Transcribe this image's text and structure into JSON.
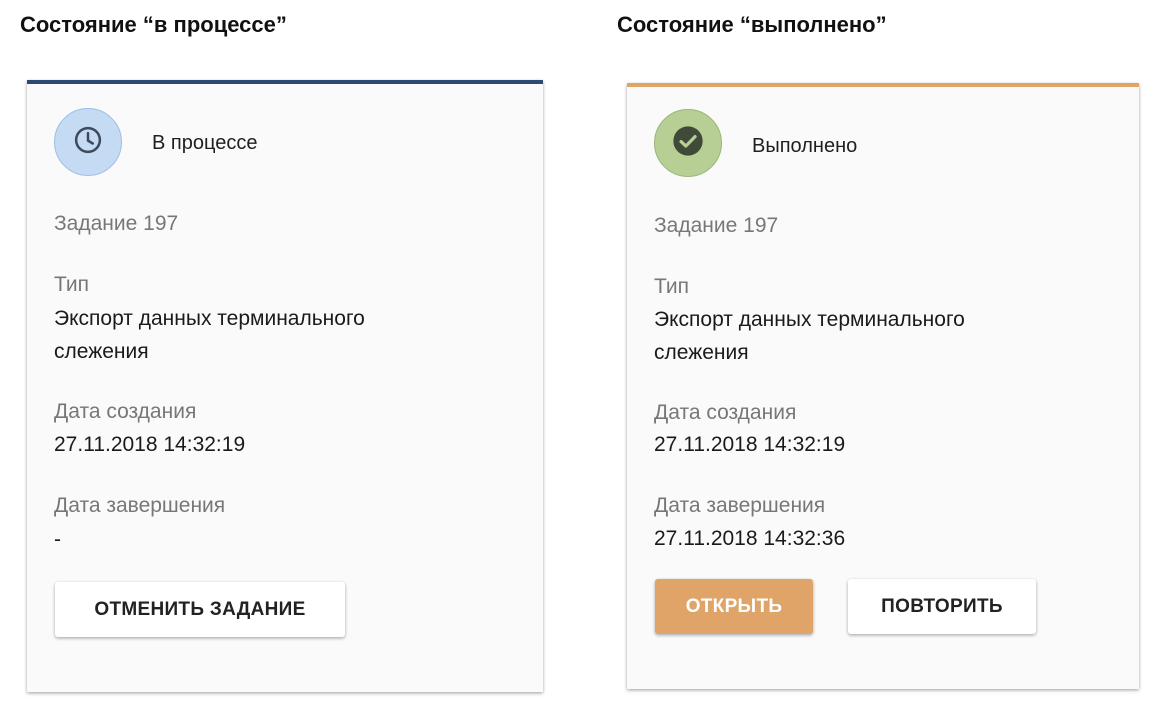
{
  "headings": {
    "in_progress": "Состояние “в процессе”",
    "done": "Состояние “выполнено”"
  },
  "colors": {
    "in_progress_accent": "#2b4a72",
    "done_accent": "#e0a468",
    "in_progress_icon_bg": "#c5daf3",
    "done_icon_bg": "#b7cf94"
  },
  "card_in_progress": {
    "status_icon": "clock-icon",
    "status": "В процессе",
    "task": "Задание 197",
    "type_label": "Тип",
    "type_value_line1": "Экспорт данных терминального",
    "type_value_line2": "слежения",
    "created_label": "Дата создания",
    "created_value": "27.11.2018 14:32:19",
    "finished_label": "Дата завершения",
    "finished_value": "-",
    "cancel_button": "ОТМЕНИТЬ ЗАДАНИЕ"
  },
  "card_done": {
    "status_icon": "check-circle-icon",
    "status": "Выполнено",
    "task": "Задание 197",
    "type_label": "Тип",
    "type_value_line1": "Экспорт данных терминального",
    "type_value_line2": "слежения",
    "created_label": "Дата создания",
    "created_value": "27.11.2018 14:32:19",
    "finished_label": "Дата завершения",
    "finished_value": "27.11.2018 14:32:36",
    "open_button": "ОТКРЫТЬ",
    "retry_button": "ПОВТОРИТЬ"
  }
}
